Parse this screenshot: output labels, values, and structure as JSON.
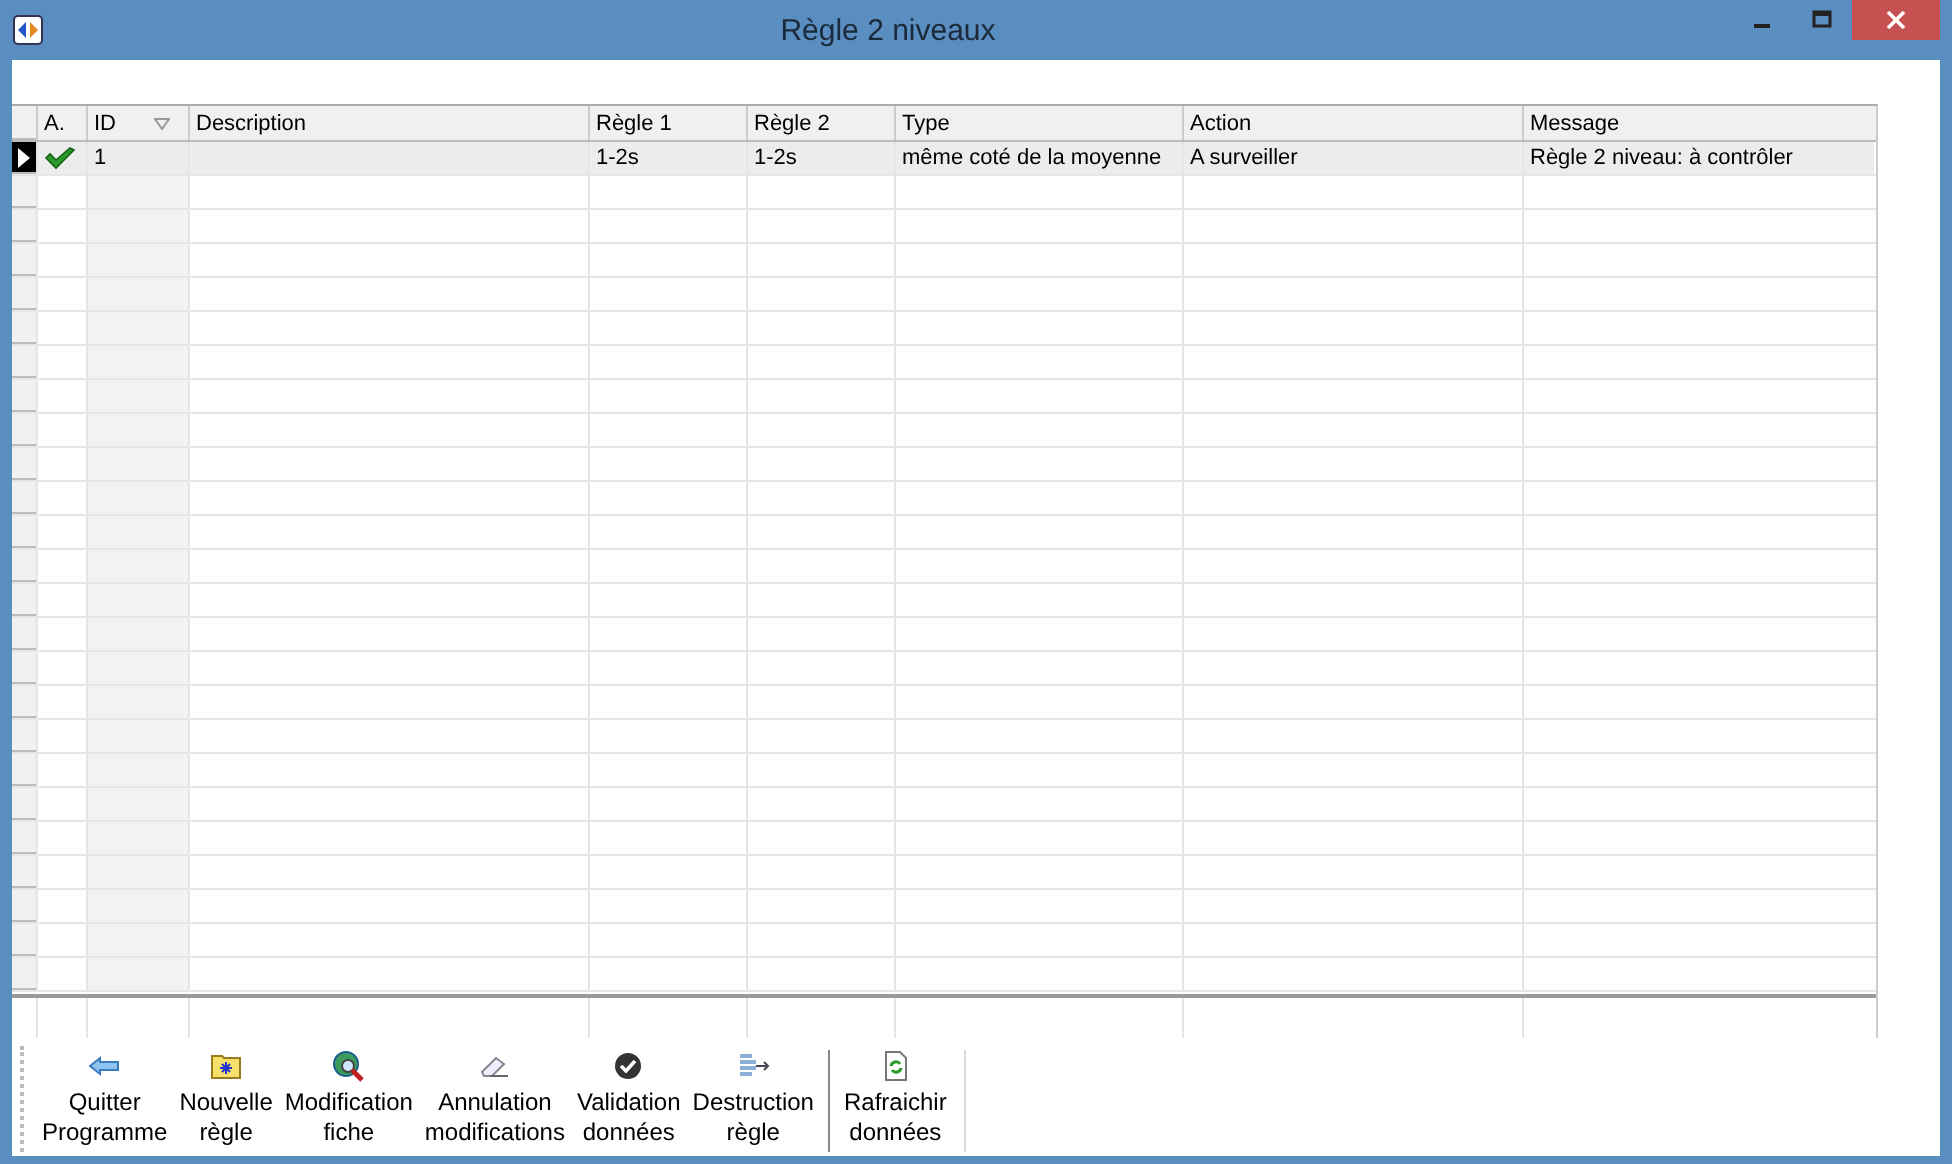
{
  "window": {
    "title": "Règle 2 niveaux"
  },
  "table": {
    "columns": [
      {
        "label": "A."
      },
      {
        "label": "ID",
        "sort_indicator": true
      },
      {
        "label": "Description"
      },
      {
        "label": "Règle 1"
      },
      {
        "label": "Règle 2"
      },
      {
        "label": "Type"
      },
      {
        "label": "Action"
      },
      {
        "label": "Message"
      }
    ],
    "rows": [
      {
        "selected": true,
        "active": true,
        "cells": [
          "",
          "1",
          "",
          "1-2s",
          "1-2s",
          "même coté de la moyenne",
          "A surveiller",
          "Règle 2 niveau: à contrôler"
        ]
      }
    ]
  },
  "toolbar": [
    {
      "kind": "quit",
      "label": [
        "Quitter",
        "Programme"
      ]
    },
    {
      "kind": "new",
      "label": [
        "Nouvelle",
        "règle"
      ]
    },
    {
      "kind": "edit",
      "label": [
        "Modification",
        "fiche"
      ]
    },
    {
      "kind": "cancel",
      "label": [
        "Annulation",
        "modifications"
      ]
    },
    {
      "kind": "validate",
      "label": [
        "Validation",
        "données"
      ]
    },
    {
      "kind": "delete",
      "label": [
        "Destruction",
        "règle"
      ]
    },
    {
      "kind": "refresh",
      "label": [
        "Rafraichir",
        "données"
      ],
      "separator_before": true
    }
  ]
}
